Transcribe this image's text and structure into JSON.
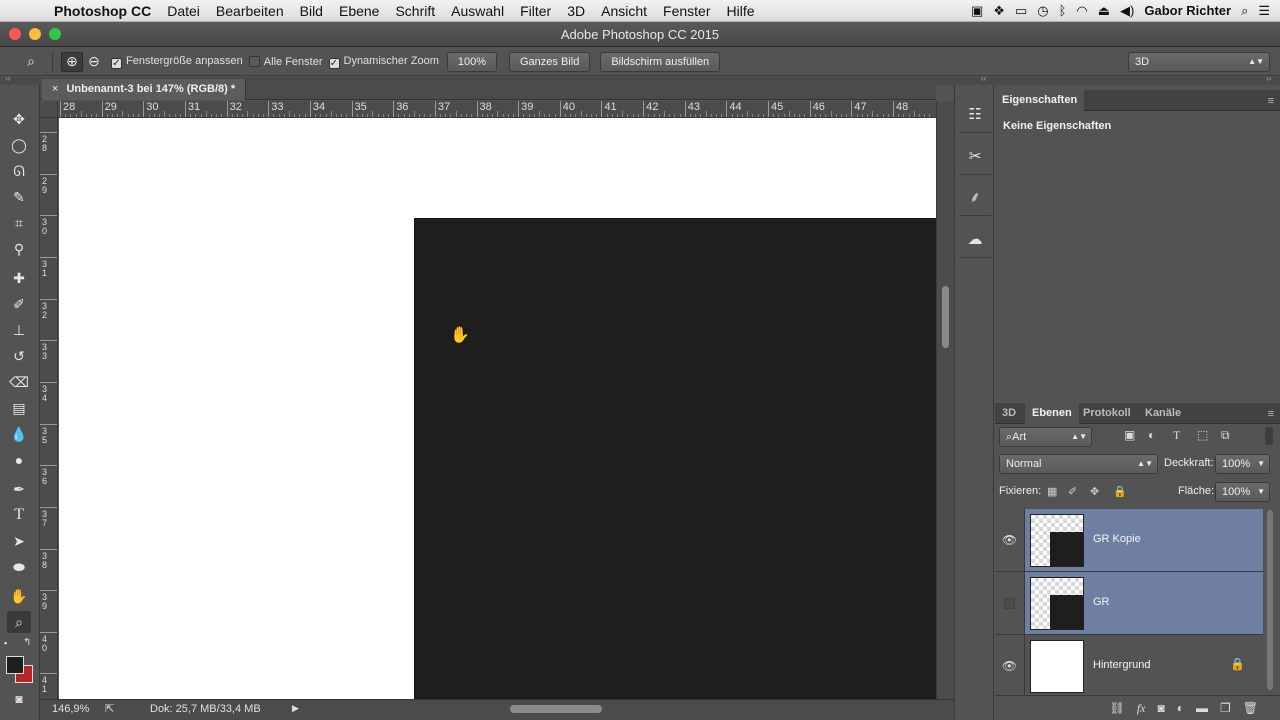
{
  "menubar": {
    "apple": "",
    "app_name": "Photoshop CC",
    "items": [
      "Datei",
      "Bearbeiten",
      "Bild",
      "Ebene",
      "Schrift",
      "Auswahl",
      "Filter",
      "3D",
      "Ansicht",
      "Fenster",
      "Hilfe"
    ],
    "user": "Gabor Richter"
  },
  "window": {
    "title": "Adobe Photoshop CC 2015"
  },
  "options": {
    "fit_window": "Fenstergröße anpassen",
    "all_windows": "Alle Fenster",
    "dynamic_zoom": "Dynamischer Zoom",
    "zoom_value": "100%",
    "fit_screen": "Ganzes Bild",
    "fill_screen": "Bildschirm ausfüllen",
    "workspace": "3D"
  },
  "document": {
    "tab_close": "×",
    "tab_title": "Unbenannt-3 bei 147% (RGB/8) *",
    "ruler_h": [
      "28",
      "29",
      "30",
      "31",
      "32",
      "33",
      "34",
      "35",
      "36",
      "37",
      "38",
      "39",
      "40",
      "41",
      "42",
      "43",
      "44",
      "45",
      "46",
      "47",
      "48"
    ],
    "ruler_v": [
      "2\n8",
      "2\n9",
      "3\n0",
      "3\n1",
      "3\n2",
      "3\n3",
      "3\n4",
      "3\n5",
      "3\n6",
      "3\n7",
      "3\n8",
      "3\n9",
      "4\n0",
      "4\n1"
    ]
  },
  "status": {
    "zoom": "146,9%",
    "doc_size": "Dok: 25,7 MB/33,4 MB"
  },
  "properties": {
    "tab": "Eigenschaften",
    "empty_text": "Keine Eigenschaften"
  },
  "layers_panel": {
    "tabs": [
      "3D",
      "Ebenen",
      "Protokoll",
      "Kanäle"
    ],
    "filter": "Art",
    "blend_mode": "Normal",
    "opacity_label": "Deckkraft:",
    "opacity_value": "100%",
    "lock_label": "Fixieren:",
    "fill_label": "Fläche:",
    "fill_value": "100%",
    "layers": [
      {
        "name": "GR Kopie",
        "visible": true,
        "selected": true
      },
      {
        "name": "GR",
        "visible": false,
        "selected": true
      },
      {
        "name": "Hintergrund",
        "visible": true,
        "selected": false,
        "locked": true
      }
    ]
  }
}
